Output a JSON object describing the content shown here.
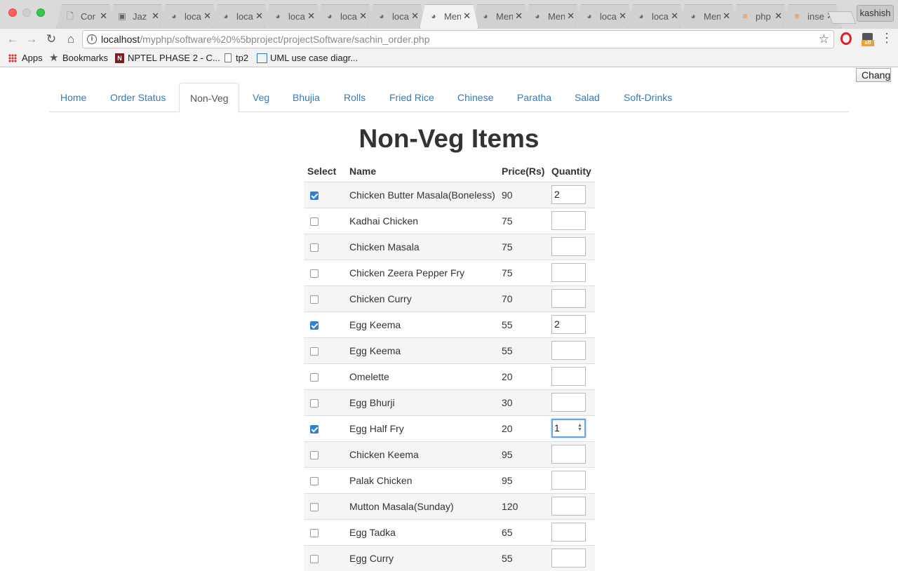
{
  "browser": {
    "tabs": [
      {
        "title": "Cor",
        "icon": "document-icon"
      },
      {
        "title": "Jaz",
        "icon": "chat-icon"
      },
      {
        "title": "loca",
        "icon": "elephant-icon"
      },
      {
        "title": "loca",
        "icon": "elephant-icon"
      },
      {
        "title": "loca",
        "icon": "elephant-icon"
      },
      {
        "title": "loca",
        "icon": "elephant-icon"
      },
      {
        "title": "loca",
        "icon": "elephant-icon"
      },
      {
        "title": "Men",
        "icon": "elephant-icon",
        "active": true
      },
      {
        "title": "Men",
        "icon": "elephant-icon"
      },
      {
        "title": "Men",
        "icon": "elephant-icon"
      },
      {
        "title": "loca",
        "icon": "elephant-icon"
      },
      {
        "title": "loca",
        "icon": "elephant-icon"
      },
      {
        "title": "Men",
        "icon": "elephant-icon"
      },
      {
        "title": "php",
        "icon": "stackoverflow-icon"
      },
      {
        "title": "inse",
        "icon": "stackoverflow-icon"
      }
    ],
    "profile": "kashish",
    "url_host": "localhost",
    "url_path": "/myphp/software%20%5bproject/projectSoftware/sachin_order.php",
    "bookmarks": {
      "apps": "Apps",
      "bookmarks": "Bookmarks",
      "nptel": "NPTEL PHASE 2 - C...",
      "tp2": "tp2",
      "uml": "UML use case diagr..."
    },
    "ext_badge": "off"
  },
  "page": {
    "change_button": "Change",
    "nav": [
      {
        "label": "Home"
      },
      {
        "label": "Order Status"
      },
      {
        "label": "Non-Veg",
        "active": true
      },
      {
        "label": "Veg"
      },
      {
        "label": "Bhujia"
      },
      {
        "label": "Rolls"
      },
      {
        "label": "Fried Rice"
      },
      {
        "label": "Chinese"
      },
      {
        "label": "Paratha"
      },
      {
        "label": "Salad"
      },
      {
        "label": "Soft-Drinks"
      }
    ],
    "title": "Non-Veg Items",
    "table": {
      "headers": [
        "Select",
        "Name",
        "Price(Rs)",
        "Quantity"
      ],
      "rows": [
        {
          "checked": true,
          "name": "Chicken Butter Masala(Boneless)",
          "price": "90",
          "qty": "2"
        },
        {
          "checked": false,
          "name": "Kadhai Chicken",
          "price": "75",
          "qty": ""
        },
        {
          "checked": false,
          "name": "Chicken Masala",
          "price": "75",
          "qty": ""
        },
        {
          "checked": false,
          "name": "Chicken Zeera Pepper Fry",
          "price": "75",
          "qty": ""
        },
        {
          "checked": false,
          "name": "Chicken Curry",
          "price": "70",
          "qty": ""
        },
        {
          "checked": true,
          "name": "Egg Keema",
          "price": "55",
          "qty": "2"
        },
        {
          "checked": false,
          "name": "Egg Keema",
          "price": "55",
          "qty": ""
        },
        {
          "checked": false,
          "name": "Omelette",
          "price": "20",
          "qty": ""
        },
        {
          "checked": false,
          "name": "Egg Bhurji",
          "price": "30",
          "qty": ""
        },
        {
          "checked": true,
          "name": "Egg Half Fry",
          "price": "20",
          "qty": "1",
          "focused": true
        },
        {
          "checked": false,
          "name": "Chicken Keema",
          "price": "95",
          "qty": ""
        },
        {
          "checked": false,
          "name": "Palak Chicken",
          "price": "95",
          "qty": ""
        },
        {
          "checked": false,
          "name": "Mutton Masala(Sunday)",
          "price": "120",
          "qty": ""
        },
        {
          "checked": false,
          "name": "Egg Tadka",
          "price": "65",
          "qty": ""
        },
        {
          "checked": false,
          "name": "Egg Curry",
          "price": "55",
          "qty": ""
        }
      ]
    }
  }
}
